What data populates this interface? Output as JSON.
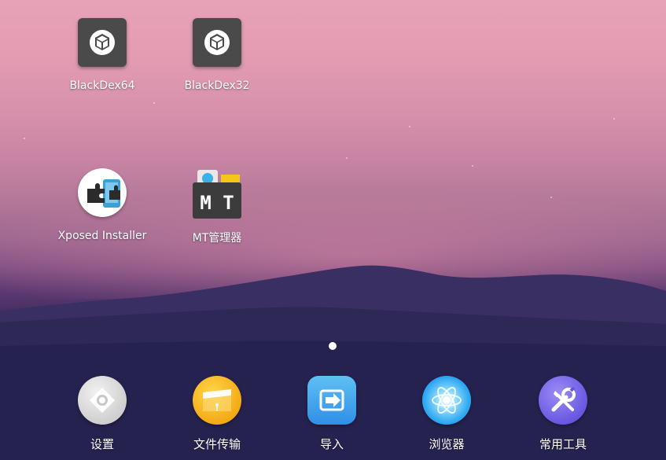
{
  "desktop": {
    "apps": [
      {
        "name": "BlackDex64",
        "icon": "cube-icon"
      },
      {
        "name": "BlackDex32",
        "icon": "cube-icon"
      },
      {
        "name": "Xposed Installer",
        "icon": "puzzle-icon"
      },
      {
        "name": "MT管理器",
        "icon": "mt-logo-icon"
      }
    ],
    "page_indicator": {
      "current": 1,
      "total": 1
    }
  },
  "dock": {
    "apps": [
      {
        "name": "设置",
        "icon": "settings-icon",
        "color": "#d9d9d9"
      },
      {
        "name": "文件传输",
        "icon": "folder-icon",
        "color": "#f5b21a"
      },
      {
        "name": "导入",
        "icon": "import-icon",
        "color": "#3a9ee8"
      },
      {
        "name": "浏览器",
        "icon": "browser-icon",
        "color": "#2fa8f2"
      },
      {
        "name": "常用工具",
        "icon": "tools-icon",
        "color": "#7a68ea"
      }
    ]
  }
}
